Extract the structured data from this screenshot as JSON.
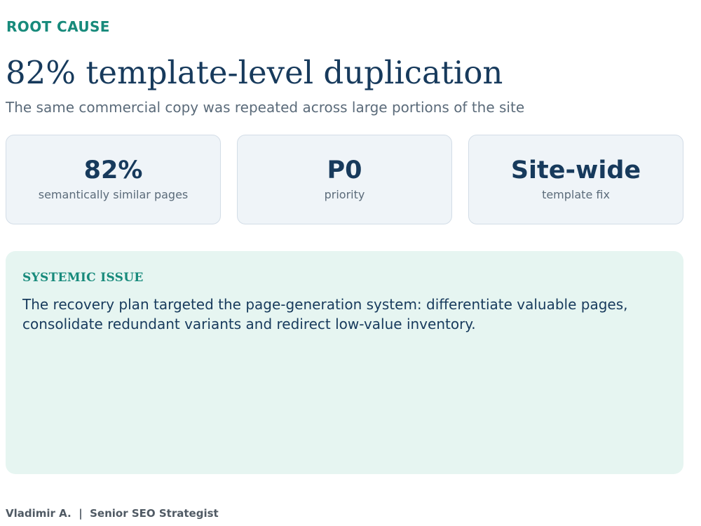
{
  "header": {
    "eyebrow": "ROOT CAUSE",
    "title": "82% template-level duplication",
    "subtitle": "The same commercial copy was repeated across large portions of the site"
  },
  "stats": [
    {
      "value": "82%",
      "label": "semantically similar pages"
    },
    {
      "value": "P0",
      "label": "priority"
    },
    {
      "value": "Site-wide",
      "label": "template fix"
    }
  ],
  "issue": {
    "title": "SYSTEMIC ISSUE",
    "body": "The recovery plan targeted the page-generation system: differentiate valuable pages, consolidate redundant variants and redirect low-value inventory."
  },
  "footer": {
    "author": "Vladimir A.",
    "separator": "|",
    "role": "Senior SEO Strategist"
  }
}
